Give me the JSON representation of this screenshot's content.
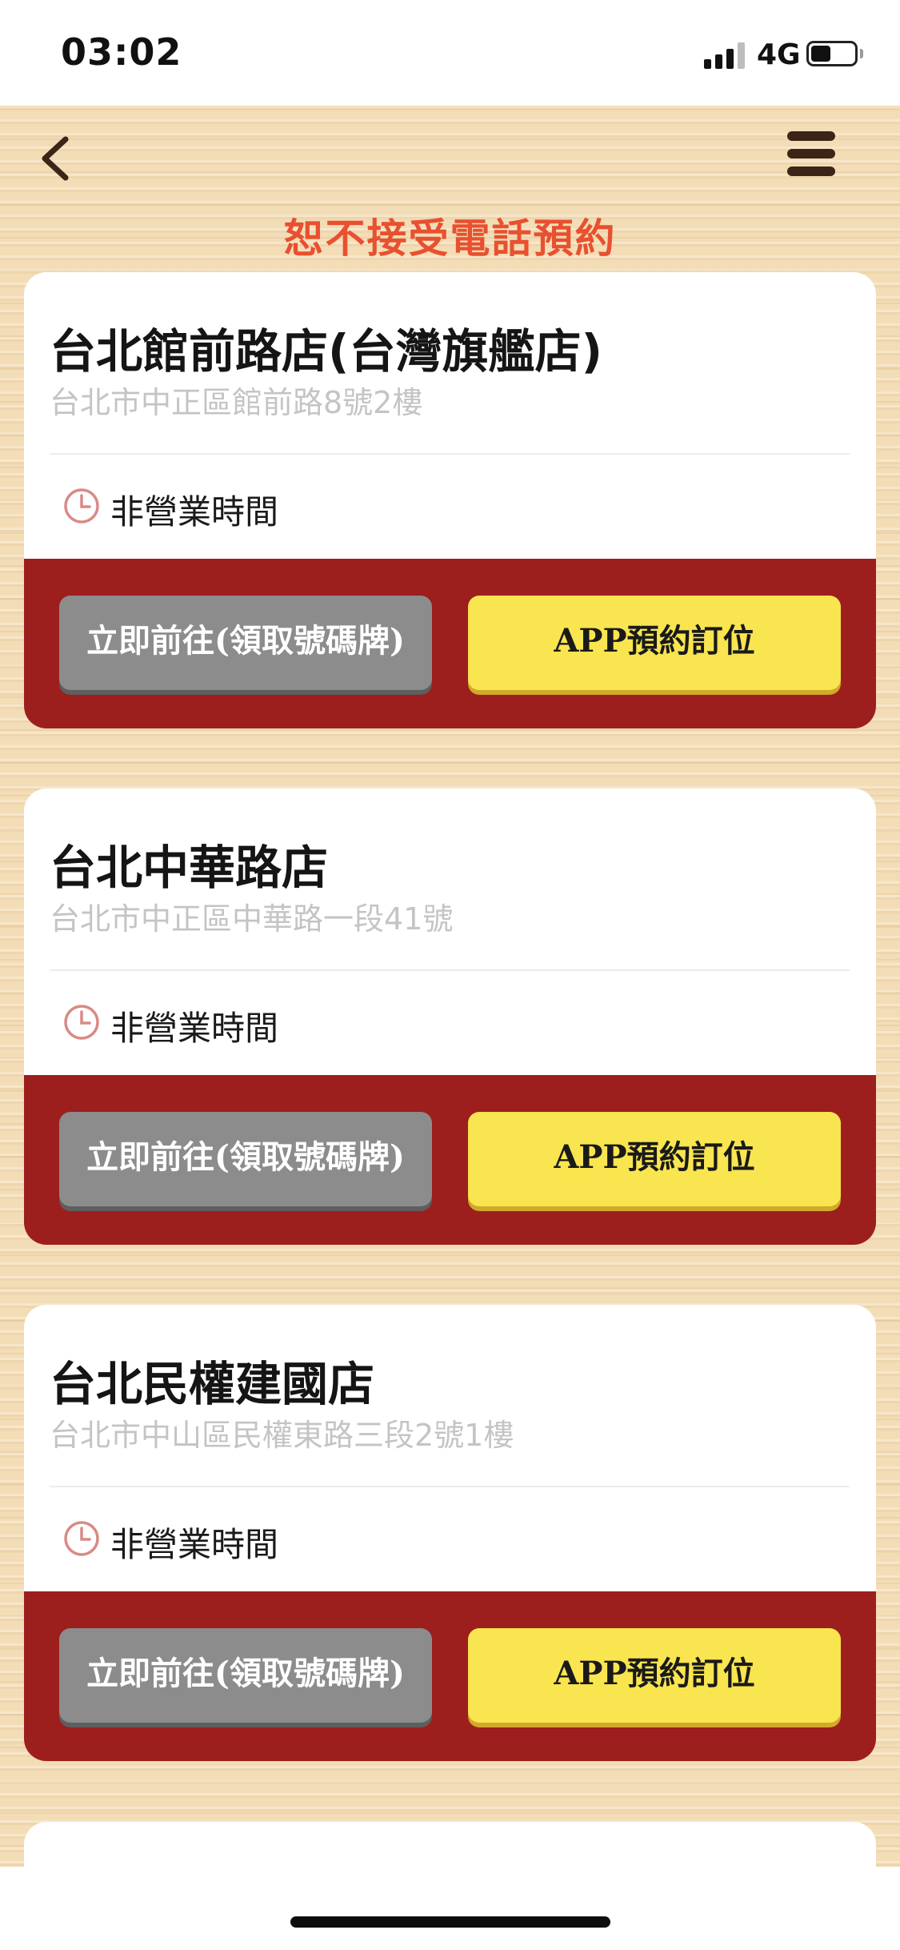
{
  "status_bar": {
    "time": "03:02",
    "network": "4G",
    "signal_bars_active": 3,
    "signal_bars_total": 4,
    "battery_level": 0.4
  },
  "header": {
    "back_icon": "chevron-left-icon",
    "menu_icon": "hamburger-menu-icon",
    "notice": "恕不接受電話預約"
  },
  "colors": {
    "notice": "#e8502f",
    "action_band": "#9c1f1d",
    "go_button": "#8c8c8c",
    "reserve_button": "#f9e54f",
    "clock_icon": "#d98a86"
  },
  "stores": [
    {
      "name": "台北館前路店(台灣旗艦店)",
      "address": "台北市中正區館前路8號2樓",
      "hours": "非營業時間",
      "go_label": "立即前往(領取號碼牌)",
      "reserve_label": "APP預約訂位"
    },
    {
      "name": "台北中華路店",
      "address": "台北市中正區中華路一段41號",
      "hours": "非營業時間",
      "go_label": "立即前往(領取號碼牌)",
      "reserve_label": "APP預約訂位"
    },
    {
      "name": "台北民權建國店",
      "address": "台北市中山區民權東路三段2號1樓",
      "hours": "非營業時間",
      "go_label": "立即前往(領取號碼牌)",
      "reserve_label": "APP預約訂位"
    }
  ]
}
